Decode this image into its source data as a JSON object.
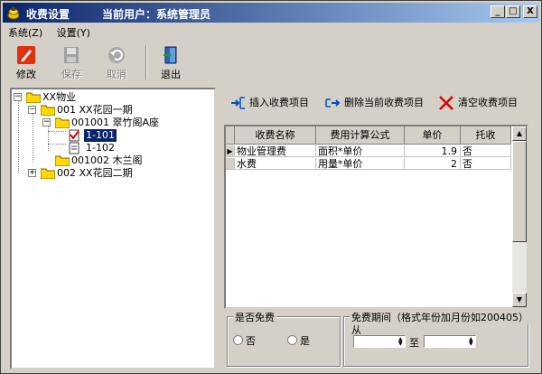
{
  "window": {
    "title": "收费设置",
    "current_user": "当前用户：系统管理员",
    "minimize": "_",
    "maximize": "□",
    "close": "X"
  },
  "menu": {
    "items": [
      "系统(Z)",
      "设置(Y)"
    ]
  },
  "toolbar": {
    "edit": "修改",
    "save": "保存",
    "cancel": "取消",
    "exit": "退出"
  },
  "tree": {
    "root": "XX物业",
    "phase1": "001 XX花园一期",
    "building": "001001 翠竹阁A座",
    "room1": "1-101",
    "room2": "1-102",
    "building2": "001002 木兰阁",
    "phase2": "002 XX花园二期"
  },
  "actions": {
    "insert": "插入收费项目",
    "delete": "删除当前收费项目",
    "clear": "清空收费项目"
  },
  "grid": {
    "columns": [
      "收费名称",
      "费用计算公式",
      "单价",
      "托收"
    ],
    "rows": [
      {
        "name": "物业管理费",
        "formula": "面积*单价",
        "price": "1.9",
        "collect": "否"
      },
      {
        "name": "水费",
        "formula": "用量*单价",
        "price": "2",
        "collect": "否"
      }
    ]
  },
  "free": {
    "legend": "是否免费",
    "option_no": "否",
    "option_yes": "是",
    "selected": "none"
  },
  "period": {
    "legend": "免费期间（格式年份加月份如200405）",
    "from_label": "从",
    "to_label": "至",
    "from_value": "",
    "to_value": ""
  }
}
